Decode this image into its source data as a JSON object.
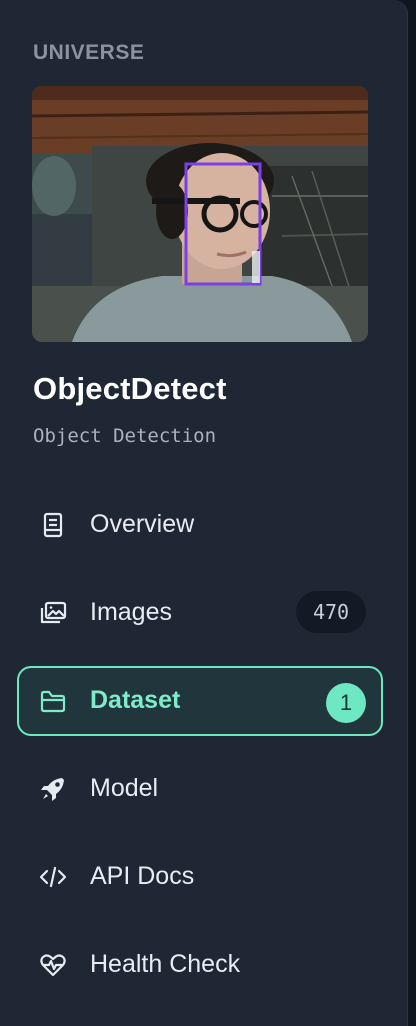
{
  "sidebar": {
    "section_label": "UNIVERSE",
    "project": {
      "name": "ObjectDetect",
      "type": "Object Detection"
    },
    "nav": [
      {
        "label": "Overview",
        "icon": "book-icon"
      },
      {
        "label": "Images",
        "icon": "images-icon",
        "count": "470"
      },
      {
        "label": "Dataset",
        "icon": "folder-icon",
        "badge": "1",
        "active": true
      },
      {
        "label": "Model",
        "icon": "rocket-icon"
      },
      {
        "label": "API Docs",
        "icon": "code-icon"
      },
      {
        "label": "Health Check",
        "icon": "heartbeat-icon"
      }
    ]
  },
  "colors": {
    "background": "#1f2734",
    "accent": "#6ee7c3",
    "bounding_box": "#7b3fe4"
  }
}
